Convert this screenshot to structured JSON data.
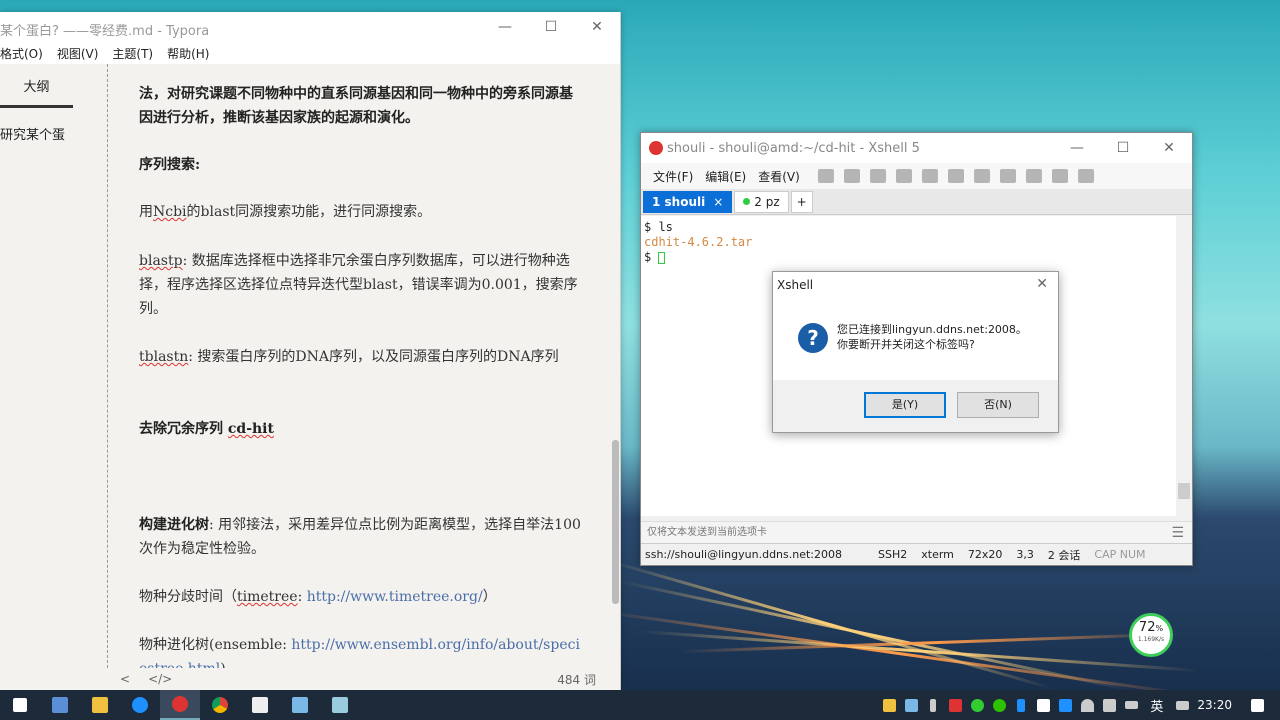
{
  "typora": {
    "title": "某个蛋白? ——零经费.md - Typora",
    "menu": [
      "格式(O)",
      "视图(V)",
      "主题(T)",
      "帮助(H)"
    ],
    "outline_tab": "大纲",
    "outline_item": "研究某个蛋",
    "content": {
      "p1": "法，对研究课题不同物种中的直系同源基因和同一物种中的旁系同源基因进行分析，推断该基因家族的起源和演化。",
      "h_seq": "序列搜索:",
      "p_blast_a": "用",
      "p_blast_b": "Ncbi",
      "p_blast_c": "的blast同源搜索功能，进行同源搜索。",
      "blastp_word": "blastp",
      "blastp_text": ": 数据库选择框中选择非冗余蛋白序列数据库，可以进行物种选择，程序选择区选择位点特异迭代型blast，错误率调为0.001，搜索序列。",
      "tblastn_word": "tblastn",
      "tblastn_text": ": 搜索蛋白序列的DNA序列，以及同源蛋白序列的DNA序列",
      "cdhit_a": "去除冗余序列 ",
      "cdhit_b": "cd-hit",
      "tree_bold": "构建进化树",
      "tree_text": ": 用邻接法，采用差异位点比例为距离模型，选择自举法100次作为稳定性检验。",
      "time_a": "物种分歧时间（",
      "time_b": "timetree",
      "time_c": ": ",
      "time_link": "http://www.timetree.org/",
      "time_d": "）",
      "ens_a": "物种进化树(ensemble: ",
      "ens_link": "http://www.ensembl.org/info/about/speciestree.html",
      "ens_b": ")"
    },
    "status_left": "<",
    "status_code": "</>",
    "word_count": "484 词"
  },
  "xshell": {
    "title": "shouli - shouli@amd:~/cd-hit - Xshell 5",
    "menu": [
      "文件(F)",
      "编辑(E)",
      "查看(V)"
    ],
    "tabs": [
      {
        "label": "1 shouli"
      },
      {
        "label": "2 pz"
      }
    ],
    "tab_add": "+",
    "terminal": {
      "line1": "$ ls",
      "line2": "cdhit-4.6.2.tar",
      "line3": "$ "
    },
    "input_hint": "仅将文本发送到当前选项卡",
    "status": {
      "host": "ssh://shouli@lingyun.ddns.net:2008",
      "proto": "SSH2",
      "term": "xterm",
      "size": "72x20",
      "pos": "3,3",
      "sessions": "2 会话",
      "caps": "CAP NUM"
    }
  },
  "dialog": {
    "title": "Xshell",
    "line1": "您已连接到lingyun.ddns.net:2008。",
    "line2": "你要断开并关闭这个标签吗?",
    "yes": "是(Y)",
    "no": "否(N)"
  },
  "network": {
    "percent": "72",
    "unit": "%",
    "speed": "1.169K/s"
  },
  "taskbar": {
    "lang": "英",
    "time": "23:20"
  },
  "colors": {
    "accent": "#0c6fd8",
    "dialog_icon": "#1a5ea8",
    "cursor": "#2ecc40"
  }
}
